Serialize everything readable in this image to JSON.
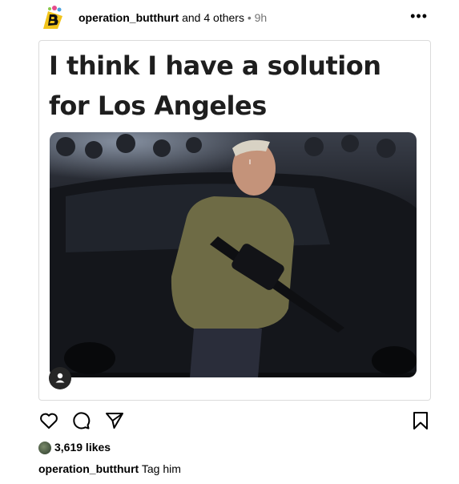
{
  "header": {
    "username": "operation_butthurt",
    "coauthors": "and 4 others",
    "separator": "•",
    "time": "9h",
    "more_label": "•••",
    "avatar_icon": "b-logo-avatar-icon"
  },
  "post": {
    "meme_line_1": "I think I have a solution",
    "meme_line_2": "for Los Angeles"
  },
  "actions": {
    "like_icon": "heart-icon",
    "comment_icon": "comment-icon",
    "share_icon": "send-icon",
    "save_icon": "bookmark-icon"
  },
  "likes": {
    "text": "3,619 likes"
  },
  "caption": {
    "username": "operation_butthurt",
    "text": "Tag him"
  },
  "colors": {
    "border": "#dbdbdb",
    "muted": "#737373",
    "avatar_yellow": "#f2c41a"
  }
}
